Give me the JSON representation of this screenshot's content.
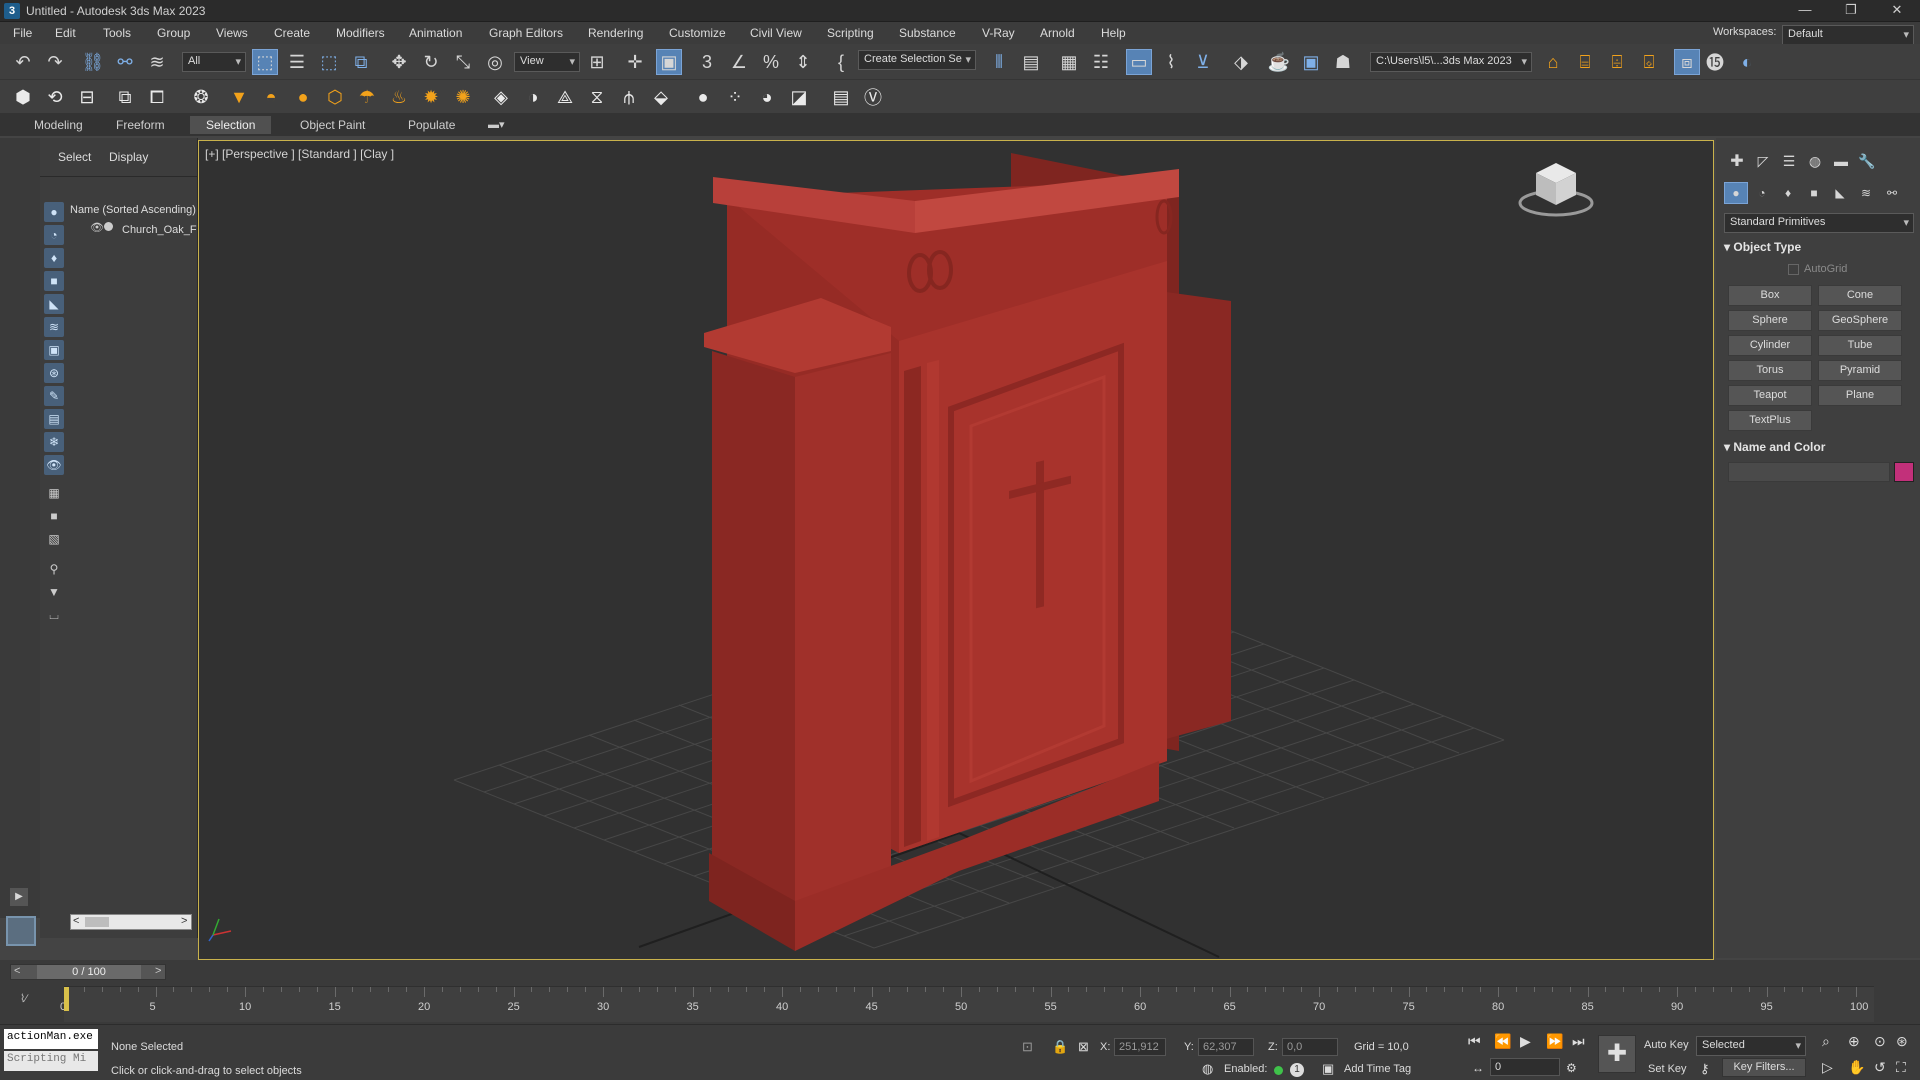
{
  "titlebar": {
    "title": "Untitled - Autodesk 3ds Max 2023",
    "app_icon": "3"
  },
  "menu": [
    "File",
    "Edit",
    "Tools",
    "Group",
    "Views",
    "Create",
    "Modifiers",
    "Animation",
    "Graph Editors",
    "Rendering",
    "Customize",
    "Civil View",
    "Scripting",
    "Substance",
    "V-Ray",
    "Arnold",
    "Help"
  ],
  "workspaces": {
    "label": "Workspaces:",
    "value": "Default"
  },
  "toolbar": {
    "filter": "All",
    "refcoord": "View",
    "selection_set": "Create Selection Se",
    "project_path": "C:\\Users\\l5\\...3ds Max 2023"
  },
  "ribbon": {
    "tabs": [
      "Modeling",
      "Freeform",
      "Selection",
      "Object Paint",
      "Populate"
    ],
    "selected": "Selection"
  },
  "scene_explorer": {
    "tabs": [
      "Select",
      "Display"
    ],
    "column": "Name (Sorted Ascending)",
    "items": [
      "Church_Oak_F"
    ]
  },
  "viewport": {
    "label": "[+] [Perspective ] [Standard ] [Clay ]",
    "object_color": "#a3302a",
    "border_color": "#c9b24c"
  },
  "command_panel": {
    "category": "Standard Primitives",
    "rollout_object_type": "Object Type",
    "autogrid": "AutoGrid",
    "buttons": [
      "Box",
      "Cone",
      "Sphere",
      "GeoSphere",
      "Cylinder",
      "Tube",
      "Torus",
      "Pyramid",
      "Teapot",
      "Plane",
      "TextPlus"
    ],
    "rollout_name_color": "Name and Color",
    "swatch_color": "#c2307a"
  },
  "timeline": {
    "slider": "0 / 100",
    "ticks": [
      "0",
      "5",
      "10",
      "15",
      "20",
      "25",
      "30",
      "35",
      "40",
      "45",
      "50",
      "55",
      "60",
      "65",
      "70",
      "75",
      "80",
      "85",
      "90",
      "95",
      "100"
    ]
  },
  "status": {
    "listener_line1": "actionMan.exe",
    "listener_line2": "Scripting Mi",
    "selection": "None Selected",
    "prompt": "Click or click-and-drag to select objects",
    "x_label": "X:",
    "x_value": "251,912",
    "y_label": "Y:",
    "y_value": "62,307",
    "z_label": "Z:",
    "z_value": "0,0",
    "grid": "Grid = 10,0",
    "enabled": "Enabled:",
    "add_time_tag": "Add Time Tag",
    "auto_key": "Auto Key",
    "set_key": "Set Key",
    "key_mode": "Selected",
    "key_filters": "Key Filters...",
    "frame": "0"
  }
}
